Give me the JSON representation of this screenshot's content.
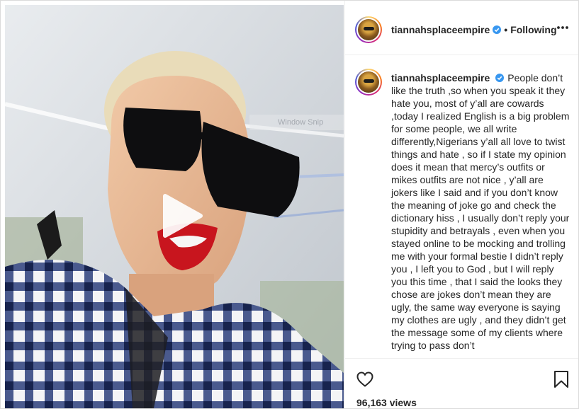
{
  "post": {
    "username": "tiannahsplaceempire",
    "follow_status": "Following",
    "separator": "•",
    "caption": "People don’t like the truth ,so when you speak it they hate you, most of y’all are cowards ,today I realized English is a big problem for some people, we all write differently,Nigerians y’all all love to twist things and hate , so if I state my opinion does it mean that mercy’s outfits or mikes outfits are not nice , y’all are jokers like I said and if you don’t know the meaning of joke go and check the dictionary hiss , I usually don’t reply your stupidity and betrayals , even when you stayed online to be mocking and trolling me with your formal bestie I didn’t reply you , I left you to God , but I will reply you this time , that I said the looks they chose are jokes don’t mean they are ugly, the same way everyone is saying my clothes are ugly , and they didn’t get the message some of my clients where trying to pass don’t",
    "views_count": "96,163",
    "views_label": "views"
  },
  "overlay": {
    "snip_text": "Window Snip"
  },
  "icons": {
    "play": "play-icon",
    "verified": "verified-badge-icon",
    "more": "more-options-icon",
    "like": "heart-icon",
    "save": "bookmark-icon"
  },
  "colors": {
    "verified_blue": "#3897f0",
    "text": "#262626",
    "border": "#efefef"
  }
}
